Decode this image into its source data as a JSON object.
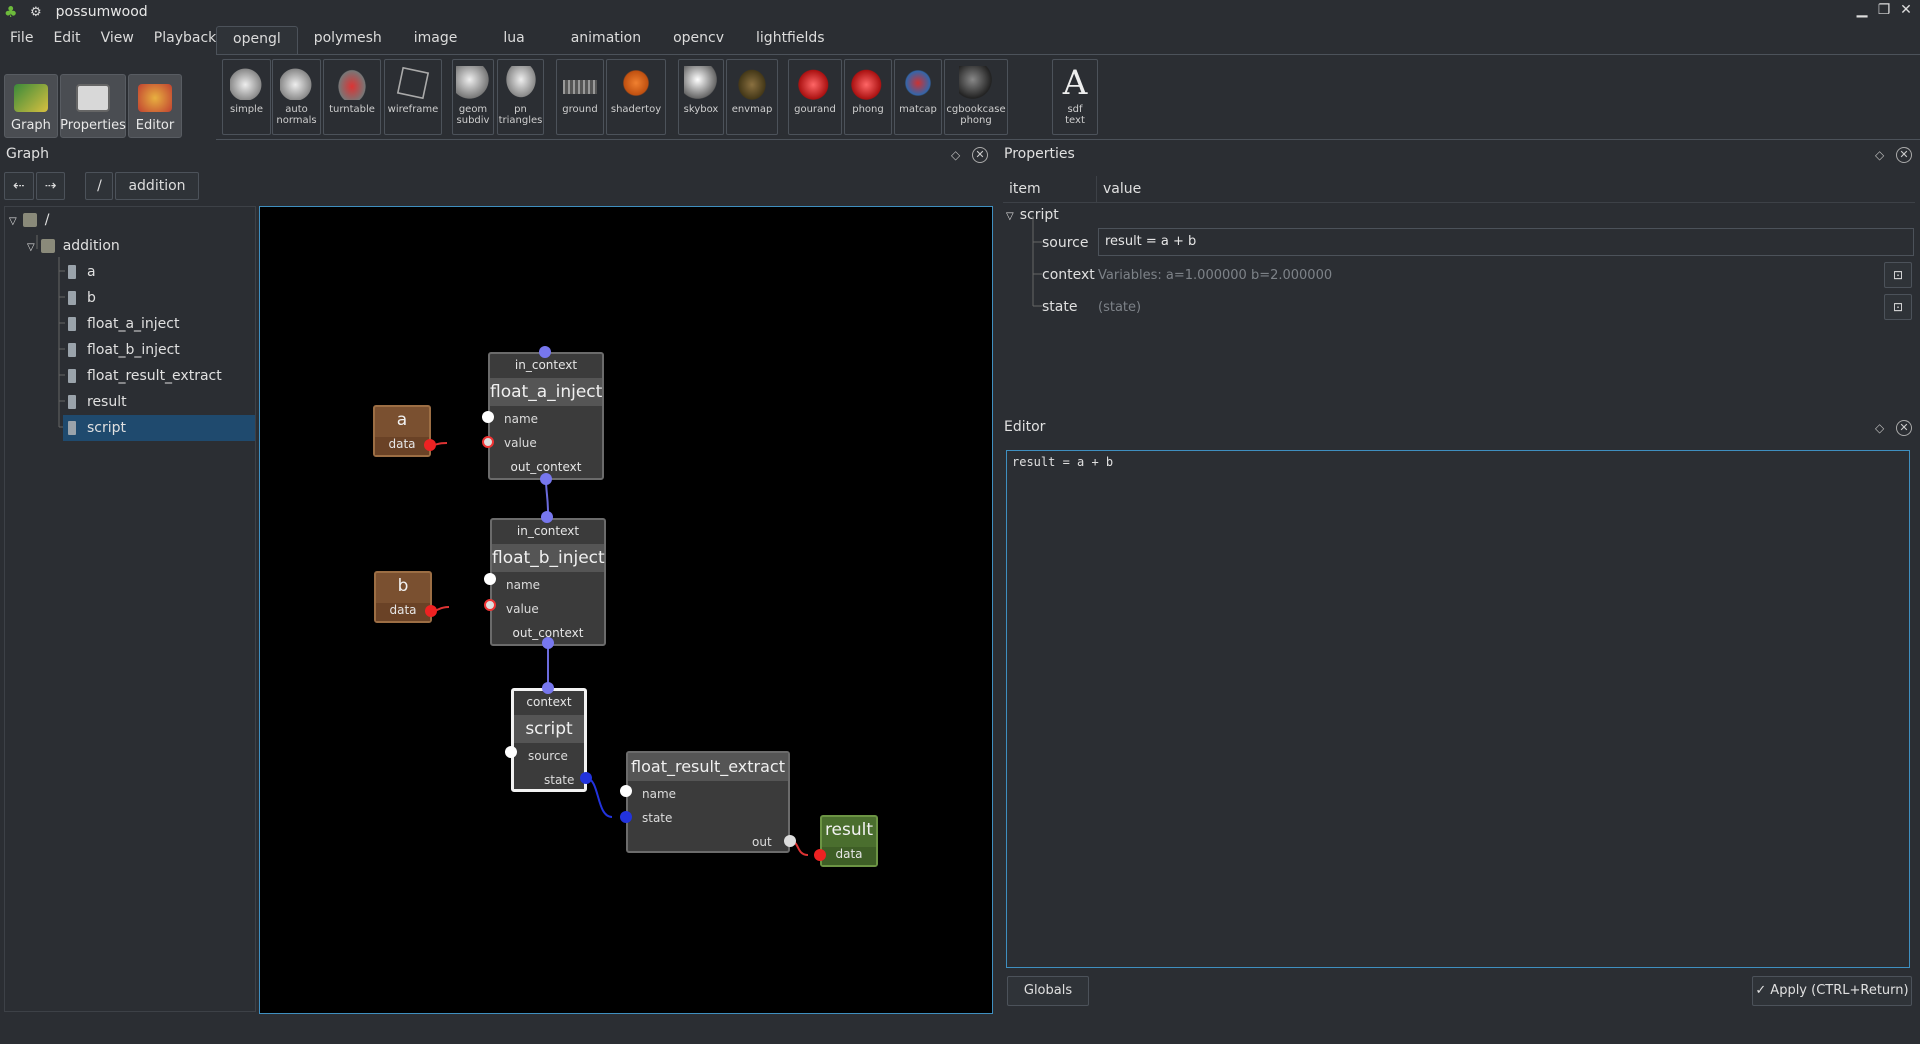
{
  "window": {
    "title": "possumwood"
  },
  "menu": [
    "File",
    "Edit",
    "View",
    "Playback"
  ],
  "tabs": [
    "opengl",
    "polymesh",
    "image",
    "lua",
    "animation",
    "opencv",
    "lightfields"
  ],
  "active_tab": "opengl",
  "left_toolbar": [
    {
      "label": "Graph",
      "icon": "graph-icon"
    },
    {
      "label": "Properties",
      "icon": "properties-icon"
    },
    {
      "label": "Editor",
      "icon": "editor-icon"
    }
  ],
  "shelf": [
    {
      "label": "simple",
      "icon": "teapot-icon"
    },
    {
      "label": "auto\nnormals",
      "icon": "teapot-icon"
    },
    {
      "label": "turntable",
      "icon": "car-icon"
    },
    {
      "label": "wireframe",
      "icon": "cube-icon"
    },
    {
      "label": "geom\nsubdiv",
      "icon": "shape-icon"
    },
    {
      "label": "pn\ntriangles",
      "icon": "shape-icon"
    },
    {
      "label": "ground",
      "icon": "ground-icon"
    },
    {
      "label": "shadertoy",
      "icon": "shadertoy-icon"
    },
    {
      "label": "skybox",
      "icon": "sphere-icon"
    },
    {
      "label": "envmap",
      "icon": "envmap-icon"
    },
    {
      "label": "gourand",
      "icon": "teapot-red-icon"
    },
    {
      "label": "phong",
      "icon": "teapot-red-icon"
    },
    {
      "label": "matcap",
      "icon": "figure-icon"
    },
    {
      "label": "cgbookcase\nphong",
      "icon": "sphere-icon"
    },
    {
      "label": "sdf\ntext",
      "icon": "letter-a-icon",
      "glyph": "A"
    }
  ],
  "graph_panel": {
    "title": "Graph",
    "breadcrumb_root": "/",
    "breadcrumb_current": "addition",
    "tree": [
      {
        "label": "/",
        "level": 0,
        "type": "folder"
      },
      {
        "label": "addition",
        "level": 1,
        "type": "folder"
      },
      {
        "label": "a",
        "level": 2,
        "type": "node"
      },
      {
        "label": "b",
        "level": 2,
        "type": "node"
      },
      {
        "label": "float_a_inject",
        "level": 2,
        "type": "node"
      },
      {
        "label": "float_b_inject",
        "level": 2,
        "type": "node"
      },
      {
        "label": "float_result_extract",
        "level": 2,
        "type": "node"
      },
      {
        "label": "result",
        "level": 2,
        "type": "node"
      },
      {
        "label": "script",
        "level": 2,
        "type": "node",
        "selected": true
      }
    ],
    "nodes": {
      "a": {
        "title": "a",
        "port": "data"
      },
      "b": {
        "title": "b",
        "port": "data"
      },
      "float_a_inject": {
        "title": "float_a_inject",
        "in": "in_context",
        "ports": [
          "name",
          "value"
        ],
        "out": "out_context"
      },
      "float_b_inject": {
        "title": "float_b_inject",
        "in": "in_context",
        "ports": [
          "name",
          "value"
        ],
        "out": "out_context"
      },
      "script": {
        "title": "script",
        "in": "context",
        "ports": [
          "source",
          "state"
        ]
      },
      "float_result_extract": {
        "title": "float_result_extract",
        "ports": [
          "name",
          "state"
        ],
        "out": "out"
      },
      "result": {
        "title": "result",
        "port": "data"
      }
    }
  },
  "properties_panel": {
    "title": "Properties",
    "columns": [
      "item",
      "value"
    ],
    "group": "script",
    "rows": [
      {
        "item": "source",
        "value": "result = a + b",
        "editable": true
      },
      {
        "item": "context",
        "value": "Variables: a=1.000000 b=2.000000",
        "editable": false
      },
      {
        "item": "state",
        "value": "(state)",
        "editable": false
      }
    ]
  },
  "editor_panel": {
    "title": "Editor",
    "code": "result = a + b",
    "globals_label": "Globals",
    "apply_label": "Apply (CTRL+Return)"
  },
  "colors": {
    "background": "#2b2e33",
    "accent": "#3f8fc0",
    "selection": "#1f4a6e",
    "source_node": "#7a5030",
    "result_node": "#4a6e2e",
    "context_port": "#7777ee",
    "data_port": "#ee2222"
  }
}
